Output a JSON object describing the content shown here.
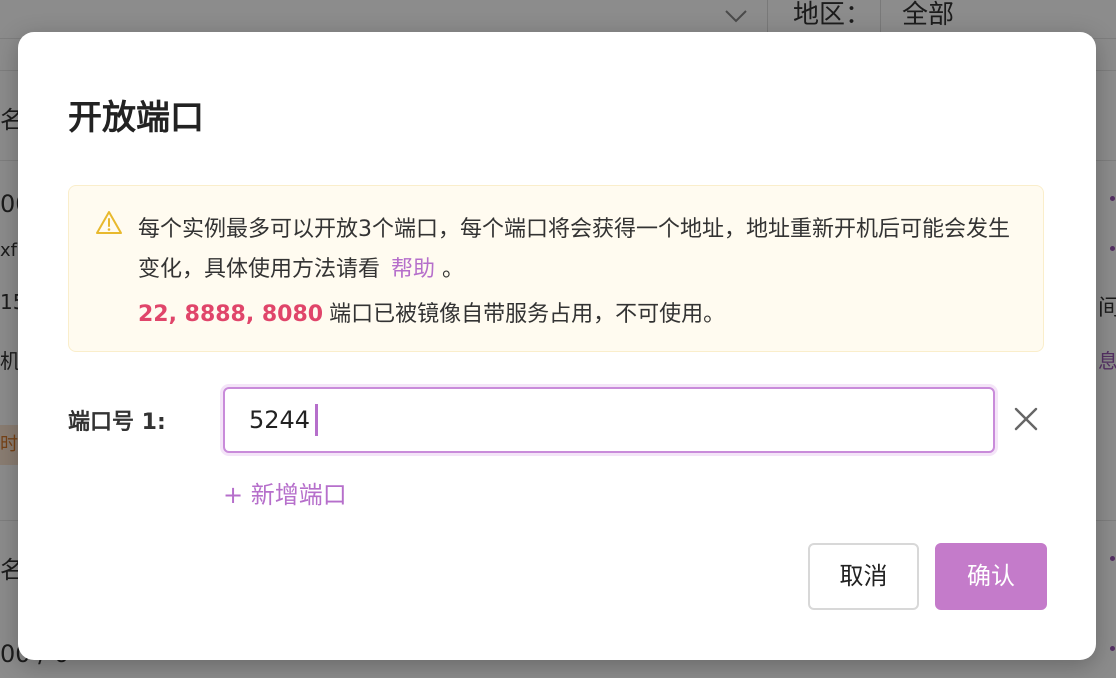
{
  "background": {
    "region_label": "地区：",
    "region_value": "全部",
    "fragments": [
      "名",
      "00",
      "xf",
      "15",
      "机",
      "时",
      "名",
      "00 / 0",
      "间",
      "息"
    ]
  },
  "modal": {
    "title": "开放端口",
    "alert": {
      "icon": "warning-triangle-icon",
      "text": "每个实例最多可以开放3个端口，每个端口将会获得一个地址，地址重新开机后可能会发生变化，具体使用方法请看",
      "help_link": "帮助",
      "trailing": "。",
      "occupied_ports": "22, 8888, 8080",
      "occupied_text": "端口已被镜像自带服务占用，不可使用。"
    },
    "port_field": {
      "label": "端口号 1:",
      "value": "5244"
    },
    "add_port": "+ 新增端口",
    "buttons": {
      "cancel": "取消",
      "confirm": "确认"
    }
  },
  "colors": {
    "accent": "#c47bca",
    "ports_highlight": "#e0456a",
    "alert_bg": "#fffbf0"
  }
}
